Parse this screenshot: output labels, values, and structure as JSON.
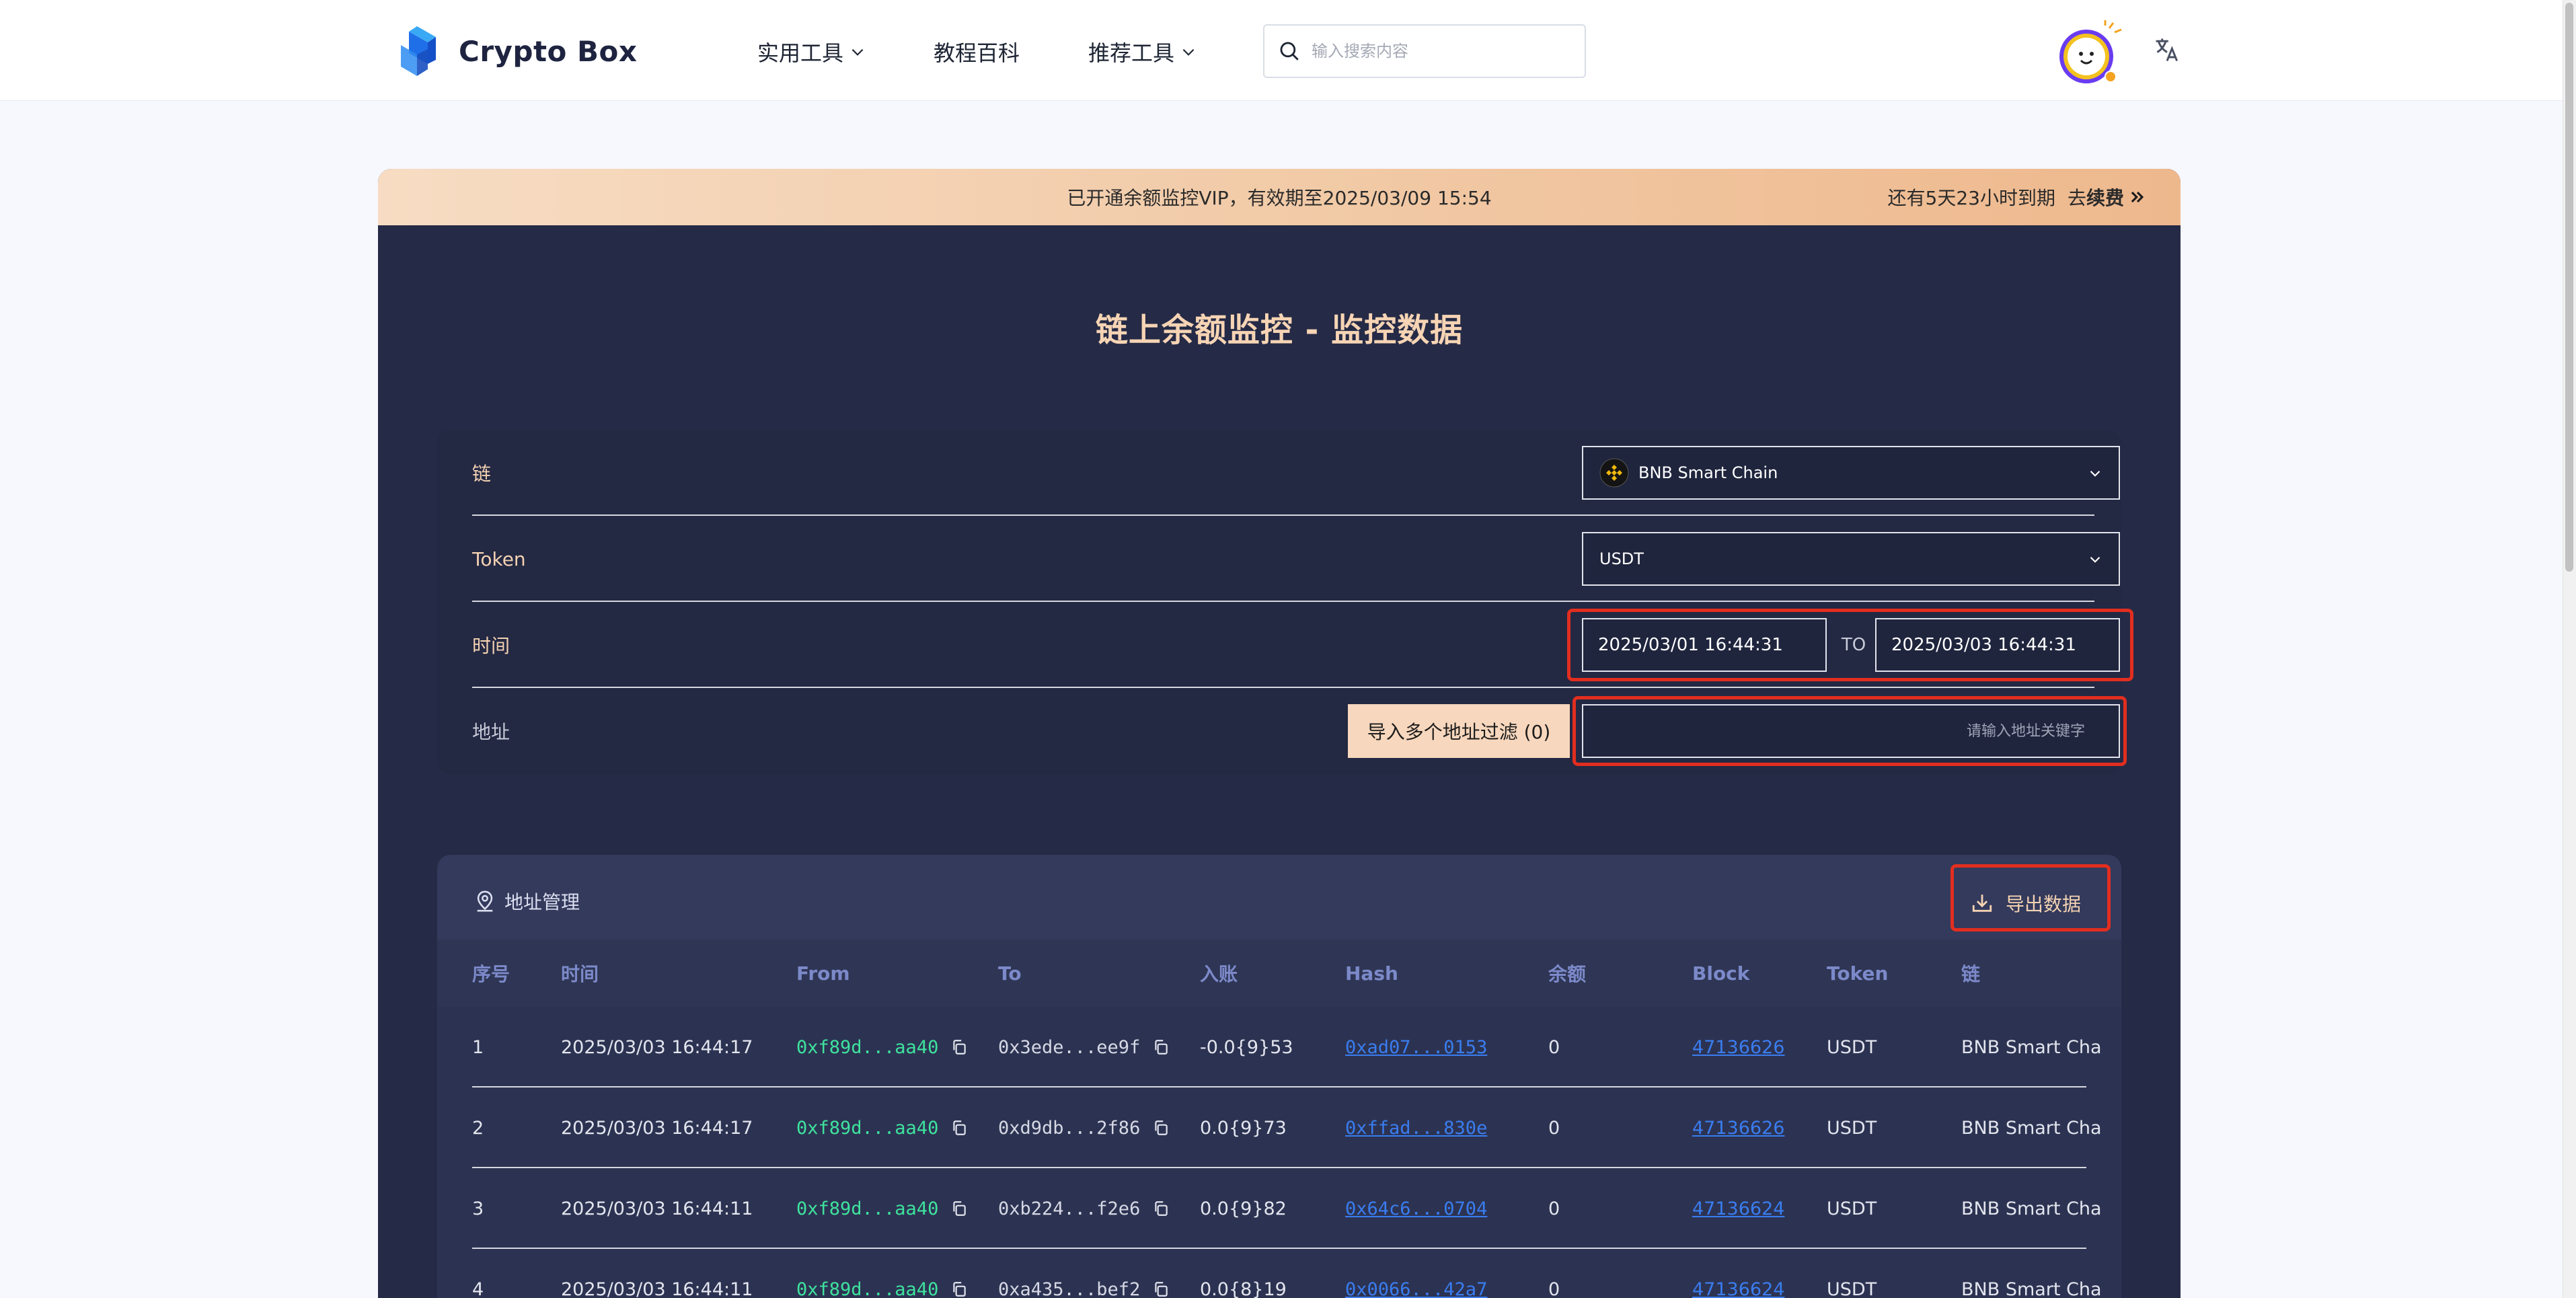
{
  "header": {
    "brand": "Crypto Box",
    "nav": {
      "tools": "实用工具",
      "tutorials": "教程百科",
      "recommended": "推荐工具"
    },
    "search": {
      "placeholder": "输入搜索内容"
    }
  },
  "vip_banner": {
    "status": "已开通余额监控VIP，有效期至2025/03/09 15:54",
    "remaining": "还有5天23小时到期",
    "renew_prefix": "去",
    "renew": "续费"
  },
  "page_title": "链上余额监控 - 监控数据",
  "filters": {
    "chain": {
      "label": "链",
      "value": "BNB Smart Chain"
    },
    "token": {
      "label": "Token",
      "value": "USDT"
    },
    "time": {
      "label": "时间",
      "from": "2025/03/01 16:44:31",
      "to_label": "TO",
      "to": "2025/03/03 16:44:31"
    },
    "address": {
      "label": "地址",
      "import_label": "导入多个地址过滤 (0)",
      "placeholder": "请输入地址关键字"
    }
  },
  "table": {
    "address_mgmt": "地址管理",
    "export": "导出数据",
    "columns": [
      "序号",
      "时间",
      "From",
      "To",
      "入账",
      "Hash",
      "余额",
      "Block",
      "Token",
      "链"
    ],
    "rows": [
      {
        "no": "1",
        "time": "2025/03/03 16:44:17",
        "from": "0xf89d...aa40",
        "to": "0x3ede...ee9f",
        "amount": "-0.0{9}53",
        "hash": "0xad07...0153",
        "balance": "0",
        "block": "47136626",
        "token": "USDT",
        "chain": "BNB Smart Chai"
      },
      {
        "no": "2",
        "time": "2025/03/03 16:44:17",
        "from": "0xf89d...aa40",
        "to": "0xd9db...2f86",
        "amount": "0.0{9}73",
        "hash": "0xffad...830e",
        "balance": "0",
        "block": "47136626",
        "token": "USDT",
        "chain": "BNB Smart Chai"
      },
      {
        "no": "3",
        "time": "2025/03/03 16:44:11",
        "from": "0xf89d...aa40",
        "to": "0xb224...f2e6",
        "amount": "0.0{9}82",
        "hash": "0x64c6...0704",
        "balance": "0",
        "block": "47136624",
        "token": "USDT",
        "chain": "BNB Smart Chai"
      },
      {
        "no": "4",
        "time": "2025/03/03 16:44:11",
        "from": "0xf89d...aa40",
        "to": "0xa435...bef2",
        "amount": "0.0{8}19",
        "hash": "0x0066...42a7",
        "balance": "0",
        "block": "47136624",
        "token": "USDT",
        "chain": "BNB Smart Chai"
      }
    ]
  },
  "colors": {
    "panel_bg": "#252a46",
    "accent_peach": "#f4d2b2",
    "from_green": "#3ee39e",
    "link_blue": "#3a7df0",
    "highlight_red": "#e22e1f"
  }
}
